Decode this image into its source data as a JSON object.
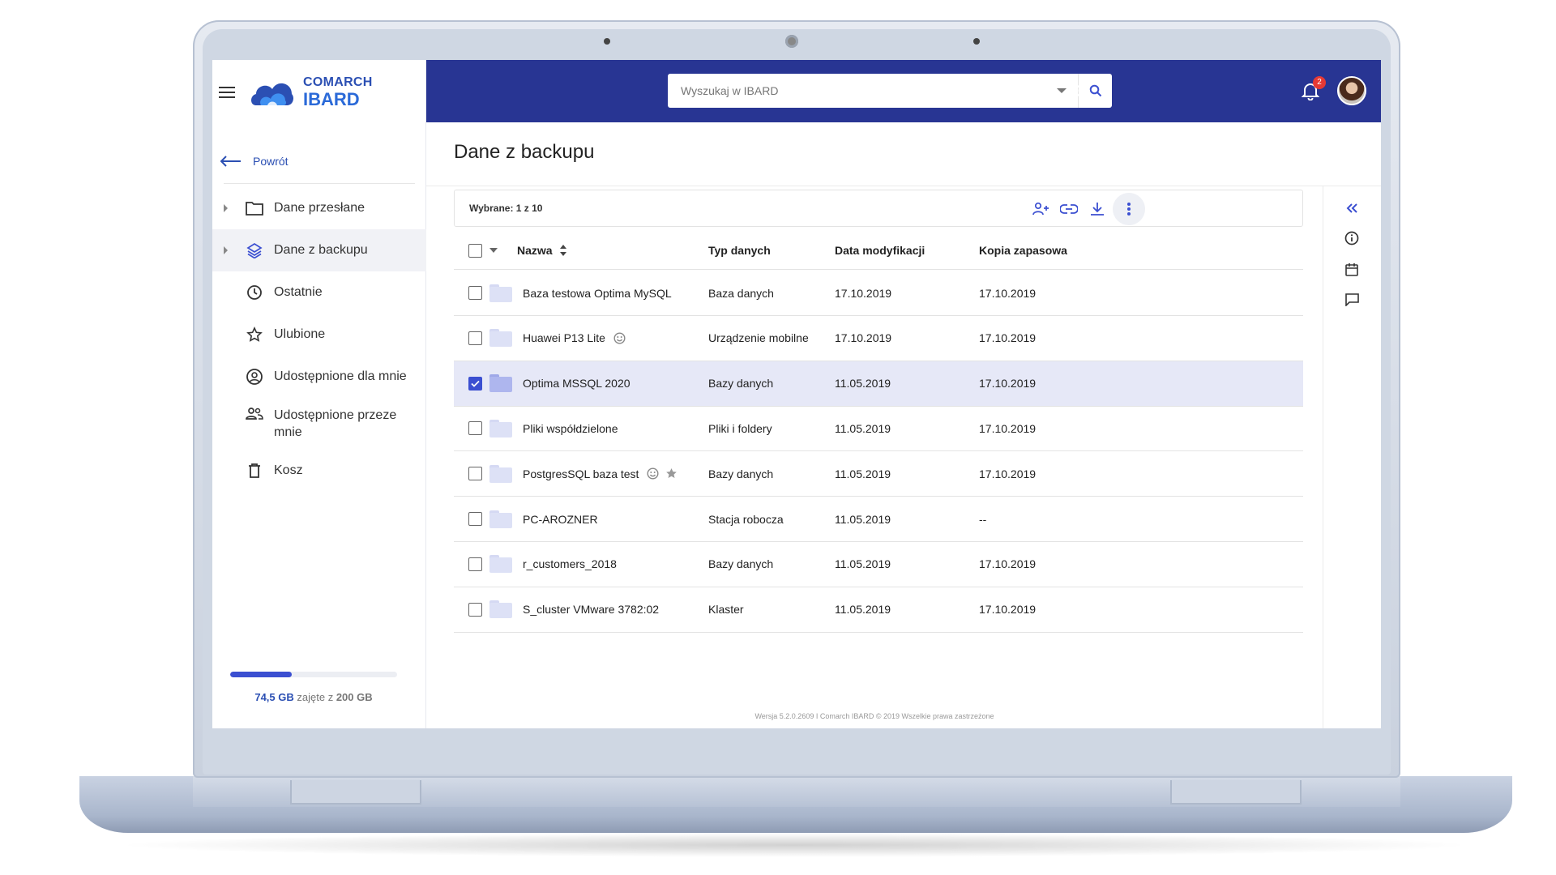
{
  "app": {
    "brand_top": "COMARCH",
    "brand_bottom": "IBARD"
  },
  "sidebar": {
    "back_label": "Powrót",
    "items": [
      {
        "label": "Dane przesłane",
        "icon": "folder-icon"
      },
      {
        "label": "Dane z backupu",
        "icon": "layers-icon",
        "active": true
      },
      {
        "label": "Ostatnie",
        "icon": "clock-icon"
      },
      {
        "label": "Ulubione",
        "icon": "star-icon"
      },
      {
        "label": "Udostępnione dla mnie",
        "icon": "account-circle-icon"
      },
      {
        "label": "Udostępnione przeze mnie",
        "icon": "people-icon"
      },
      {
        "label": "Kosz",
        "icon": "trash-icon"
      }
    ],
    "storage": {
      "used": "74,5 GB",
      "middle": "zajęte z",
      "total": "200 GB",
      "fraction": 0.37
    }
  },
  "search": {
    "placeholder": "Wyszukaj w IBARD"
  },
  "topbar": {
    "notifications_count": "2"
  },
  "page": {
    "title": "Dane z backupu"
  },
  "selection": {
    "text": "Wybrane: 1 z 10"
  },
  "table": {
    "headers": {
      "name": "Nazwa",
      "type": "Typ danych",
      "modified": "Data modyfikacji",
      "backup": "Kopia zapasowa"
    },
    "rows": [
      {
        "name": "Baza testowa Optima MySQL",
        "type": "Baza danych",
        "modified": "17.10.2019",
        "backup": "17.10.2019"
      },
      {
        "name": "Huawei P13 Lite",
        "type": "Urządzenie mobilne",
        "modified": "17.10.2019",
        "backup": "17.10.2019"
      },
      {
        "name": "Optima MSSQL 2020",
        "type": "Bazy danych",
        "modified": "11.05.2019",
        "backup": "17.10.2019",
        "selected": true
      },
      {
        "name": "Pliki współdzielone",
        "type": "Pliki i foldery",
        "modified": "11.05.2019",
        "backup": "17.10.2019"
      },
      {
        "name": "PostgresSQL baza test",
        "type": "Bazy danych",
        "modified": "11.05.2019",
        "backup": "17.10.2019"
      },
      {
        "name": "PC-AROZNER",
        "type": "Stacja robocza",
        "modified": "11.05.2019",
        "backup": "--"
      },
      {
        "name": "r_customers_2018",
        "type": "Bazy danych",
        "modified": "11.05.2019",
        "backup": "17.10.2019"
      },
      {
        "name": "S_cluster VMware 3782:02",
        "type": "Klaster",
        "modified": "11.05.2019",
        "backup": "17.10.2019"
      }
    ]
  },
  "footer": {
    "text": "Wersja  5.2.0.2609  I   Comarch IBARD  © 2019 Wszelkie prawa zastrzeżone"
  },
  "colors": {
    "topbar": "#283593",
    "accent": "#3b4fd1",
    "selected_row": "#e6e8f7"
  }
}
